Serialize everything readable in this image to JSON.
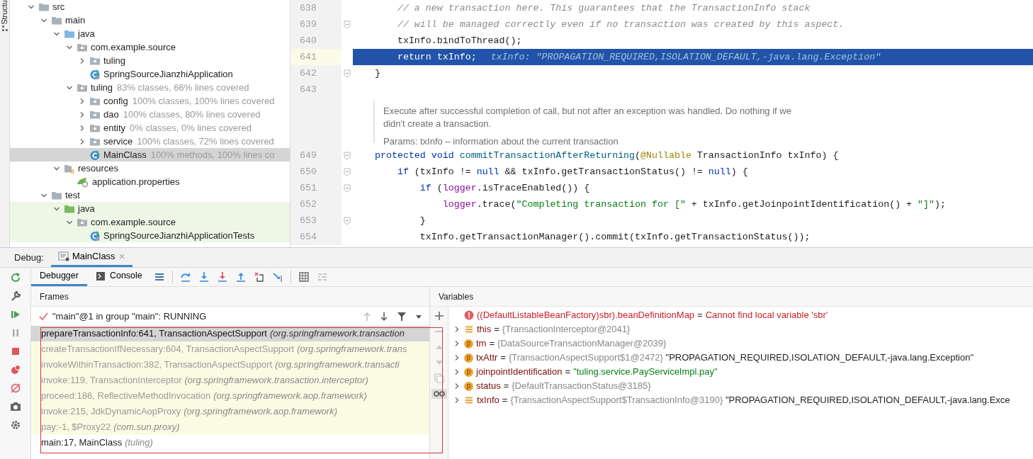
{
  "side_tab": "Structu",
  "tree": [
    {
      "label": "src",
      "kind": "folder",
      "expanded": true,
      "selected": false,
      "tinted": false,
      "children": [
        {
          "label": "main",
          "kind": "folder",
          "expanded": true,
          "selected": false,
          "tinted": false,
          "children": [
            {
              "label": "java",
              "kind": "source-folder",
              "expanded": true,
              "selected": false,
              "tinted": false,
              "children": [
                {
                  "label": "com.example.source",
                  "kind": "package",
                  "expanded": true,
                  "selected": false,
                  "tinted": false,
                  "children": [
                    {
                      "label": "tuling",
                      "kind": "package",
                      "expanded": false,
                      "selected": false,
                      "tinted": false
                    },
                    {
                      "label": "SpringSourceJianzhiApplication",
                      "kind": "spring-class",
                      "selected": false,
                      "tinted": false
                    }
                  ]
                },
                {
                  "label": "tuling",
                  "coverage": "83% classes, 66% lines covered",
                  "kind": "package",
                  "expanded": true,
                  "selected": false,
                  "tinted": false,
                  "children": [
                    {
                      "label": "config",
                      "coverage": "100% classes, 100% lines covered",
                      "kind": "package",
                      "expanded": false,
                      "selected": false,
                      "tinted": false
                    },
                    {
                      "label": "dao",
                      "coverage": "100% classes, 80% lines covered",
                      "kind": "package",
                      "expanded": false,
                      "selected": false,
                      "tinted": false
                    },
                    {
                      "label": "entity",
                      "coverage": "0% classes, 0% lines covered",
                      "kind": "package",
                      "expanded": false,
                      "selected": false,
                      "tinted": false
                    },
                    {
                      "label": "service",
                      "coverage": "100% classes, 72% lines covered",
                      "kind": "package",
                      "expanded": false,
                      "selected": false,
                      "tinted": false
                    },
                    {
                      "label": "MainClass",
                      "coverage": "100% methods, 100% lines co",
                      "kind": "class",
                      "selected": true,
                      "tinted": false
                    }
                  ]
                }
              ]
            },
            {
              "label": "resources",
              "kind": "resources-folder",
              "expanded": true,
              "selected": false,
              "tinted": false,
              "children": [
                {
                  "label": "application.properties",
                  "kind": "properties",
                  "selected": false,
                  "tinted": false
                }
              ]
            }
          ]
        },
        {
          "label": "test",
          "kind": "folder",
          "expanded": true,
          "selected": false,
          "tinted": false,
          "children": [
            {
              "label": "java",
              "kind": "test-folder",
              "expanded": true,
              "selected": false,
              "tinted": true,
              "children": [
                {
                  "label": "com.example.source",
                  "kind": "package",
                  "expanded": true,
                  "selected": false,
                  "tinted": true,
                  "children": [
                    {
                      "label": "SpringSourceJianzhiApplicationTests",
                      "kind": "spring-class",
                      "selected": false,
                      "tinted": true
                    }
                  ]
                }
              ]
            }
          ]
        }
      ]
    }
  ],
  "editor": {
    "lines": [
      {
        "kind": "code",
        "number": "638",
        "fold": false,
        "current": false,
        "segments": [
          {
            "text": "    // a new transaction here. This guarantees that the TransactionInfo stack",
            "kind": "comment"
          }
        ]
      },
      {
        "kind": "code",
        "number": "639",
        "fold": true,
        "current": false,
        "segments": [
          {
            "text": "    // will be managed correctly even if no transaction was created by this aspect.",
            "kind": "comment"
          }
        ]
      },
      {
        "kind": "code",
        "number": "640",
        "fold": false,
        "current": false,
        "segments": [
          {
            "text": "    txInfo.bindToThread();",
            "kind": "plain"
          }
        ]
      },
      {
        "kind": "code",
        "number": "641",
        "fold": false,
        "current": true,
        "segments": [
          {
            "text": "    return txInfo;",
            "kind": "plain"
          },
          {
            "text": "txInfo: \"PROPAGATION_REQUIRED,ISOLATION_DEFAULT,-java.lang.Exception\"",
            "kind": "hint"
          }
        ]
      },
      {
        "kind": "code",
        "number": "642",
        "fold": true,
        "current": false,
        "segments": [
          {
            "text": "}",
            "kind": "plain"
          }
        ]
      },
      {
        "kind": "code",
        "number": "643",
        "fold": false,
        "current": false
      },
      {
        "kind": "doc",
        "text": "Execute after successful completion of call, but not after an exception was handled. Do nothing if we didn't create a transaction.",
        "params": "Params: txInfo – information about the current transaction"
      },
      {
        "kind": "code",
        "number": "649",
        "fold": true,
        "current": false,
        "segments": [
          {
            "text": "protected void ",
            "kind": "keyword"
          },
          {
            "text": "commitTransactionAfterReturning",
            "kind": "method"
          },
          {
            "text": "(",
            "kind": "plain"
          },
          {
            "text": "@Nullable",
            "kind": "annotation"
          },
          {
            "text": " TransactionInfo txInfo) {",
            "kind": "plain"
          }
        ]
      },
      {
        "kind": "code",
        "number": "650",
        "fold": true,
        "current": false,
        "segments": [
          {
            "text": "    if",
            "kind": "keyword"
          },
          {
            "text": " (txInfo != ",
            "kind": "plain"
          },
          {
            "text": "null",
            "kind": "keyword"
          },
          {
            "text": " && txInfo.getTransactionStatus() != ",
            "kind": "plain"
          },
          {
            "text": "null",
            "kind": "keyword"
          },
          {
            "text": ") {",
            "kind": "plain"
          }
        ]
      },
      {
        "kind": "code",
        "number": "651",
        "fold": true,
        "current": false,
        "segments": [
          {
            "text": "        if",
            "kind": "keyword"
          },
          {
            "text": " (",
            "kind": "plain"
          },
          {
            "text": "logger",
            "kind": "field"
          },
          {
            "text": ".isTraceEnabled()) {",
            "kind": "plain"
          }
        ]
      },
      {
        "kind": "code",
        "number": "652",
        "fold": false,
        "current": false,
        "segments": [
          {
            "text": "            logger",
            "kind": "field"
          },
          {
            "text": ".trace(",
            "kind": "plain"
          },
          {
            "text": "\"Completing transaction for [\"",
            "kind": "string"
          },
          {
            "text": " + txInfo.getJoinpointIdentification() + ",
            "kind": "plain"
          },
          {
            "text": "\"]\"",
            "kind": "string"
          },
          {
            "text": ");",
            "kind": "plain"
          }
        ]
      },
      {
        "kind": "code",
        "number": "653",
        "fold": true,
        "current": false,
        "segments": [
          {
            "text": "        }",
            "kind": "plain"
          }
        ]
      },
      {
        "kind": "code",
        "number": "654",
        "fold": false,
        "current": false,
        "segments": [
          {
            "text": "        txInfo.getTransactionManager().commit(txInfo.getTransactionStatus());",
            "kind": "plain"
          }
        ]
      }
    ]
  },
  "debug": {
    "label": "Debug:",
    "tabs": [
      {
        "label": "MainClass",
        "selected": true
      }
    ],
    "views": [
      {
        "label": "Debugger",
        "selected": true
      },
      {
        "label": "Console",
        "selected": false
      }
    ],
    "frames": {
      "title": "Frames",
      "thread": "\"main\"@1 in group \"main\": RUNNING",
      "items": [
        {
          "method": "prepareTransactionInfo:641, TransactionAspectSupport",
          "package": "(org.springframework.transaction",
          "selected": true,
          "library": false
        },
        {
          "method": "createTransactionIfNecessary:604, TransactionAspectSupport",
          "package": "(org.springframework.trans",
          "selected": false,
          "library": true
        },
        {
          "method": "invokeWithinTransaction:382, TransactionAspectSupport",
          "package": "(org.springframework.transacti",
          "selected": false,
          "library": true
        },
        {
          "method": "invoke:119, TransactionInterceptor",
          "package": "(org.springframework.transaction.interceptor)",
          "selected": false,
          "library": true
        },
        {
          "method": "proceed:186, ReflectiveMethodInvocation",
          "package": "(org.springframework.aop.framework)",
          "selected": false,
          "library": true
        },
        {
          "method": "invoke:215, JdkDynamicAopProxy",
          "package": "(org.springframework.aop.framework)",
          "selected": false,
          "library": true
        },
        {
          "method": "pay:-1, $Proxy22",
          "package": "(com.sun.proxy)",
          "selected": false,
          "library": true
        },
        {
          "method": "main:17, MainClass",
          "package": "(tuling)",
          "selected": false,
          "library": false
        }
      ]
    },
    "variables": {
      "title": "Variables",
      "items": [
        {
          "kind": "error",
          "expandable": false,
          "name": "((DefaultListableBeanFactory)sbr).beanDefinitionMap",
          "op": "=",
          "message": "Cannot find local variable 'sbr'"
        },
        {
          "kind": "field",
          "expandable": true,
          "name": "this",
          "op": "=",
          "ref": "{TransactionInterceptor@2041}"
        },
        {
          "kind": "param",
          "expandable": true,
          "badge": "p",
          "name": "tm",
          "op": "=",
          "ref": "{DataSourceTransactionManager@2039}"
        },
        {
          "kind": "param",
          "expandable": true,
          "badge": "p",
          "name": "txAttr",
          "op": "=",
          "ref": "{TransactionAspectSupport$1@2472}",
          "text": "\"PROPAGATION_REQUIRED,ISOLATION_DEFAULT,-java.lang.Exception\""
        },
        {
          "kind": "param",
          "expandable": true,
          "badge": "p",
          "name": "joinpointIdentification",
          "op": "=",
          "string": "\"tuling.service.PayServiceImpl.pay\""
        },
        {
          "kind": "param",
          "expandable": true,
          "badge": "p",
          "name": "status",
          "op": "=",
          "ref": "{DefaultTransactionStatus@3185}"
        },
        {
          "kind": "field",
          "expandable": true,
          "name": "txInfo",
          "op": "=",
          "ref": "{TransactionAspectSupport$TransactionInfo@3190}",
          "text": "\"PROPAGATION_REQUIRED,ISOLATION_DEFAULT,-java.lang.Exce"
        }
      ]
    }
  }
}
